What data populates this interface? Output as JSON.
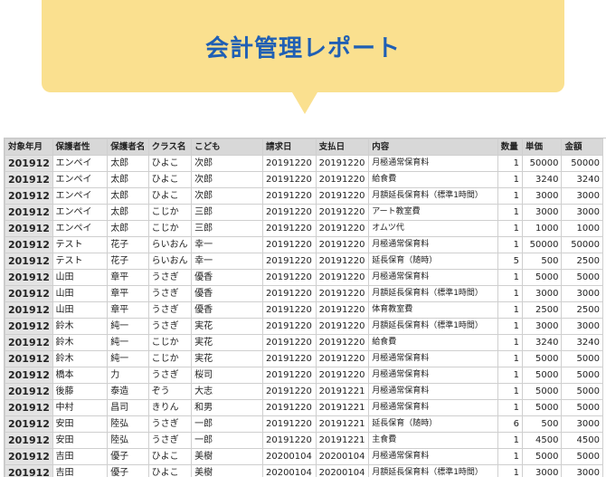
{
  "banner": {
    "title": "会計管理レポート"
  },
  "table": {
    "headers": [
      "対象年月",
      "保護者性",
      "保護者名",
      "クラス名",
      "こども",
      "請求日",
      "支払日",
      "内容",
      "数量",
      "単価",
      "金額"
    ],
    "rows": [
      [
        "201912",
        "エンペイ",
        "太郎",
        "ひよこ",
        "次郎",
        "20191220",
        "20191220",
        "月極通常保育料",
        "1",
        "50000",
        "50000"
      ],
      [
        "201912",
        "エンペイ",
        "太郎",
        "ひよこ",
        "次郎",
        "20191220",
        "20191220",
        "給食費",
        "1",
        "3240",
        "3240"
      ],
      [
        "201912",
        "エンペイ",
        "太郎",
        "ひよこ",
        "次郎",
        "20191220",
        "20191220",
        "月額延長保育料（標準1時間）",
        "1",
        "3000",
        "3000"
      ],
      [
        "201912",
        "エンペイ",
        "太郎",
        "こじか",
        "三郎",
        "20191220",
        "20191220",
        "アート教室費",
        "1",
        "3000",
        "3000"
      ],
      [
        "201912",
        "エンペイ",
        "太郎",
        "こじか",
        "三郎",
        "20191220",
        "20191220",
        "オムツ代",
        "1",
        "1000",
        "1000"
      ],
      [
        "201912",
        "テスト",
        "花子",
        "らいおん",
        "幸一",
        "20191220",
        "20191220",
        "月極通常保育料",
        "1",
        "50000",
        "50000"
      ],
      [
        "201912",
        "テスト",
        "花子",
        "らいおん",
        "幸一",
        "20191220",
        "20191220",
        "延長保育（随時）",
        "5",
        "500",
        "2500"
      ],
      [
        "201912",
        "山田",
        "章平",
        "うさぎ",
        "優香",
        "20191220",
        "20191220",
        "月極通常保育料",
        "1",
        "5000",
        "5000"
      ],
      [
        "201912",
        "山田",
        "章平",
        "うさぎ",
        "優香",
        "20191220",
        "20191220",
        "月額延長保育料（標準1時間）",
        "1",
        "3000",
        "3000"
      ],
      [
        "201912",
        "山田",
        "章平",
        "うさぎ",
        "優香",
        "20191220",
        "20191220",
        "体育教室費",
        "1",
        "2500",
        "2500"
      ],
      [
        "201912",
        "鈴木",
        "純一",
        "うさぎ",
        "実花",
        "20191220",
        "20191220",
        "月額延長保育料（標準1時間）",
        "1",
        "3000",
        "3000"
      ],
      [
        "201912",
        "鈴木",
        "純一",
        "こじか",
        "実花",
        "20191220",
        "20191220",
        "給食費",
        "1",
        "3240",
        "3240"
      ],
      [
        "201912",
        "鈴木",
        "純一",
        "こじか",
        "実花",
        "20191220",
        "20191220",
        "月極通常保育料",
        "1",
        "5000",
        "5000"
      ],
      [
        "201912",
        "橋本",
        "力",
        "うさぎ",
        "桜司",
        "20191220",
        "20191220",
        "月極通常保育料",
        "1",
        "5000",
        "5000"
      ],
      [
        "201912",
        "後藤",
        "泰造",
        "ぞう",
        "大志",
        "20191220",
        "20191221",
        "月極通常保育料",
        "1",
        "5000",
        "5000"
      ],
      [
        "201912",
        "中村",
        "昌司",
        "きりん",
        "和男",
        "20191220",
        "20191221",
        "月極通常保育料",
        "1",
        "5000",
        "5000"
      ],
      [
        "201912",
        "安田",
        "陸弘",
        "うさぎ",
        "一郎",
        "20191220",
        "20191221",
        "延長保育（随時）",
        "6",
        "500",
        "3000"
      ],
      [
        "201912",
        "安田",
        "陸弘",
        "うさぎ",
        "一郎",
        "20191220",
        "20191221",
        "主食費",
        "1",
        "4500",
        "4500"
      ],
      [
        "201912",
        "吉田",
        "優子",
        "ひよこ",
        "美樹",
        "20200104",
        "20200104",
        "月極通常保育料",
        "1",
        "5000",
        "5000"
      ],
      [
        "201912",
        "吉田",
        "優子",
        "ひよこ",
        "美樹",
        "20200104",
        "20200104",
        "月額延長保育料（標準1時間）",
        "1",
        "3000",
        "3000"
      ]
    ]
  }
}
